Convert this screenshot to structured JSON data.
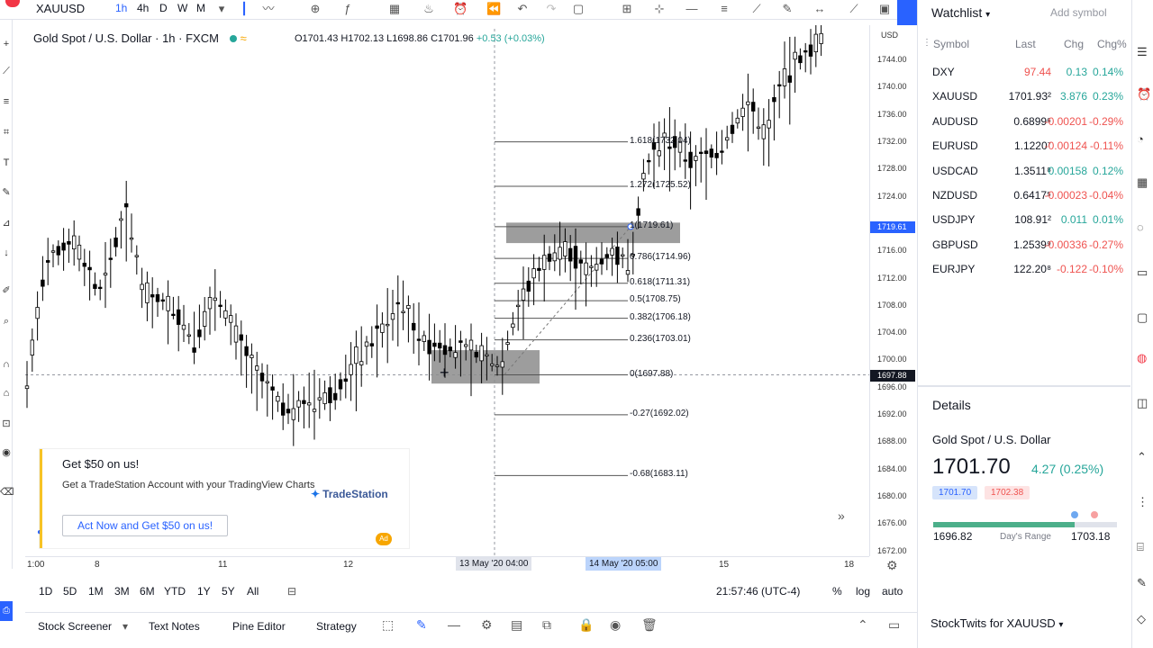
{
  "toolbar": {
    "symbol": "XAUUSD",
    "intervals": [
      "1h",
      "4h",
      "D",
      "W",
      "M"
    ],
    "active_interval": "1h"
  },
  "legend": {
    "name": "Gold Spot / U.S. Dollar",
    "interval": "1h",
    "source": "FXCM",
    "ohlc": "O1701.43 H1702.13 L1698.86 C1701.96",
    "change": "+0.53 (+0.03%)"
  },
  "price_axis": {
    "currency": "USD",
    "labels": [
      "1744.00",
      "1740.00",
      "1736.00",
      "1732.00",
      "1728.00",
      "1724.00",
      "1716.00",
      "1712.00",
      "1708.00",
      "1704.00",
      "1700.00",
      "1696.00",
      "1692.00",
      "1688.00",
      "1684.00",
      "1680.00",
      "1676.00",
      "1672.00"
    ],
    "label_values": [
      1744,
      1740,
      1736,
      1732,
      1728,
      1724,
      1716,
      1712,
      1708,
      1704,
      1700,
      1696,
      1692,
      1688,
      1684,
      1680,
      1676,
      1672
    ],
    "crosshair_price": "1719.61",
    "last_price": "1697.88"
  },
  "time_axis": {
    "labels": [
      "1:00",
      "8",
      "11",
      "12",
      "15",
      "18"
    ],
    "crosshair_time": "13 May '20  04:00",
    "range_end": "14 May '20  05:00"
  },
  "fibonacci": [
    {
      "level": "1.618(1732.04)",
      "price": 1732.04
    },
    {
      "level": "1.272(1725.52)",
      "price": 1725.52
    },
    {
      "level": "1(1719.61)",
      "price": 1719.61
    },
    {
      "level": "0.786(1714.96)",
      "price": 1714.96
    },
    {
      "level": "0.618(1711.31)",
      "price": 1711.31
    },
    {
      "level": "0.5(1708.75)",
      "price": 1708.75
    },
    {
      "level": "0.382(1706.18)",
      "price": 1706.18
    },
    {
      "level": "0.236(1703.01)",
      "price": 1703.01
    },
    {
      "level": "0(1697.88)",
      "price": 1697.88
    },
    {
      "level": "-0.27(1692.02)",
      "price": 1692.02
    },
    {
      "level": "-0.68(1683.11)",
      "price": 1683.11
    }
  ],
  "ad": {
    "title": "Get $50 on us!",
    "text": "Get a TradeStation Account with your TradingView Charts",
    "brand": "TradeStation",
    "button": "Act Now and Get $50 on us!",
    "tag": "Ad"
  },
  "range_bar": {
    "ranges": [
      "1D",
      "5D",
      "1M",
      "3M",
      "6M",
      "YTD",
      "1Y",
      "5Y",
      "All"
    ],
    "clock": "21:57:46 (UTC-4)",
    "percent": "%",
    "log": "log",
    "auto": "auto"
  },
  "bottom_panel": {
    "tabs": [
      "Stock Screener",
      "Text Notes",
      "Pine Editor",
      "Strategy"
    ]
  },
  "watchlist": {
    "title": "Watchlist",
    "add_symbol": "Add symbol",
    "columns": [
      "Symbol",
      "Last",
      "Chg",
      "Chg%"
    ],
    "rows": [
      {
        "symbol": "DXY",
        "last": "97.44",
        "chg": "0.13",
        "chgp": "0.14%",
        "dir": "pos"
      },
      {
        "symbol": "XAUUSD",
        "last": "1701.93²",
        "chg": "3.876",
        "chgp": "0.23%",
        "dir": "pos"
      },
      {
        "symbol": "AUDUSD",
        "last": "0.6899⁶",
        "chg": "-0.00201",
        "chgp": "-0.29%",
        "dir": "neg"
      },
      {
        "symbol": "EURUSD",
        "last": "1.1220⁷",
        "chg": "-0.00124",
        "chgp": "-0.11%",
        "dir": "neg"
      },
      {
        "symbol": "USDCAD",
        "last": "1.3511⁸",
        "chg": "0.00158",
        "chgp": "0.12%",
        "dir": "pos"
      },
      {
        "symbol": "NZDUSD",
        "last": "0.6417⁵",
        "chg": "-0.00023",
        "chgp": "-0.04%",
        "dir": "neg"
      },
      {
        "symbol": "USDJPY",
        "last": "108.91²",
        "chg": "0.011",
        "chgp": "0.01%",
        "dir": "pos"
      },
      {
        "symbol": "GBPUSD",
        "last": "1.2539⁹",
        "chg": "-0.00336",
        "chgp": "-0.27%",
        "dir": "neg"
      },
      {
        "symbol": "EURJPY",
        "last": "122.20⁸",
        "chg": "-0.122",
        "chgp": "-0.10%",
        "dir": "neg"
      }
    ]
  },
  "details": {
    "title": "Details",
    "name": "Gold Spot / U.S. Dollar",
    "price": "1701.70",
    "change": "4.27 (0.25%)",
    "bid": "1701.70",
    "ask": "1702.38",
    "low": "1696.82",
    "range_label": "Day's Range",
    "high": "1703.18",
    "range_position": 0.77
  },
  "stocktwits": "StockTwits for XAUUSD",
  "colors": {
    "accent": "#2962ff",
    "up": "#26a69a",
    "down": "#ef5350",
    "candle": "#000000"
  }
}
